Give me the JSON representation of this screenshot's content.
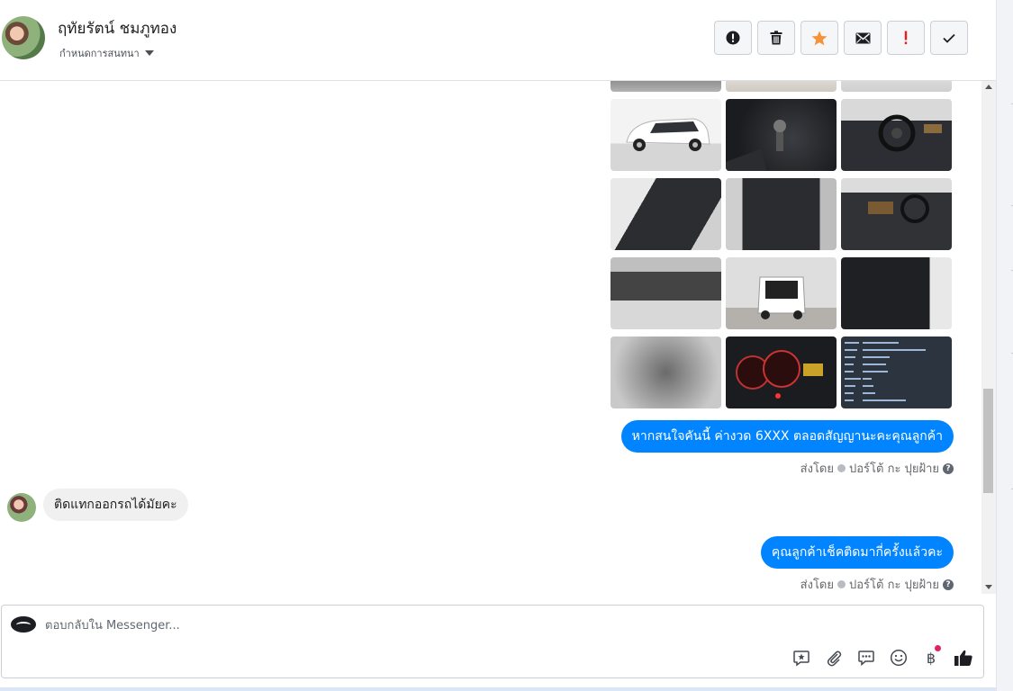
{
  "header": {
    "contact_name": "ฤทัยรัตน์ ชมภูทอง",
    "assign_label": "กำหนดการสนทนา",
    "actions": [
      "alert-icon",
      "trash-icon",
      "star-icon",
      "envelope-icon",
      "exclamation-icon",
      "check-icon"
    ]
  },
  "colors": {
    "accent": "#0084ff",
    "incoming_bubble": "#f0f0f0",
    "star": "#f7923b",
    "danger": "#e0245e"
  },
  "thread": {
    "photos": [
      {
        "name": "partial-top-1"
      },
      {
        "name": "partial-top-2"
      },
      {
        "name": "partial-top-3"
      },
      {
        "name": "white-van-exterior"
      },
      {
        "name": "gear-shift-console"
      },
      {
        "name": "dashboard-steering-wheel"
      },
      {
        "name": "front-seats"
      },
      {
        "name": "rear-seats"
      },
      {
        "name": "dashboard-interior"
      },
      {
        "name": "third-row-seats"
      },
      {
        "name": "rear-open-trunk"
      },
      {
        "name": "door-panel"
      },
      {
        "name": "engine-bay"
      },
      {
        "name": "instrument-cluster"
      },
      {
        "name": "vehicle-details-doc"
      }
    ],
    "messages": [
      {
        "type": "outgoing",
        "text": "หากสนใจคันนี้ ค่างวด 6XXX ตลอดสัญญานะคะคุณลูกค้า",
        "sent_by_label": "ส่งโดย",
        "sender": "ปอร์โต้ กะ ปุยฝ้าย"
      },
      {
        "type": "incoming",
        "text": "ติดแทกออกรถได้มัยคะ"
      },
      {
        "type": "outgoing",
        "text": "คุณลูกค้าเช็คติดมากี่ครั้งแล้วคะ",
        "sent_by_label": "ส่งโดย",
        "sender": "ปอร์โต้ กะ ปุยฝ้าย"
      }
    ]
  },
  "composer": {
    "placeholder": "ตอบกลับใน Messenger...",
    "tools": [
      "saved-reply-icon",
      "attachment-icon",
      "chat-bubble-icon",
      "emoji-icon",
      "baht-payment-icon",
      "thumbs-up-icon"
    ],
    "baht_symbol": "฿"
  }
}
